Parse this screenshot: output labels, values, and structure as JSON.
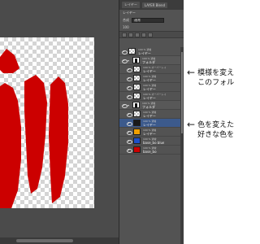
{
  "panel": {
    "tabs": [
      "レイヤー",
      "LAYER Blend"
    ],
    "header_text": "レイヤー",
    "blend_label": "合成",
    "blend_value": "通常",
    "opacity_label": "100",
    "layers": [
      {
        "pct": "100 % 通常",
        "name": "レイヤー",
        "thumb": "checker",
        "indent": 0,
        "type": "layer",
        "selected": false
      },
      {
        "pct": "100 % 通常",
        "name": "フォルダ",
        "thumb": "folder",
        "indent": 0,
        "type": "folder",
        "selected": false
      },
      {
        "pct": "100 % オーバーレイ",
        "name": "レイヤー",
        "thumb": "checker",
        "indent": 1,
        "type": "layer",
        "selected": false
      },
      {
        "pct": "100 % 通常",
        "name": "レイヤー",
        "thumb": "checker",
        "indent": 1,
        "type": "layer",
        "selected": false
      },
      {
        "pct": "100 % 通常",
        "name": "レイヤー",
        "thumb": "checker",
        "indent": 1,
        "type": "layer",
        "selected": false
      },
      {
        "pct": "100 % オーバーレイ",
        "name": "レイヤー",
        "thumb": "checker",
        "indent": 1,
        "type": "layer",
        "selected": false
      },
      {
        "pct": "100 % 通常",
        "name": "フォルダ",
        "thumb": "folder",
        "indent": 0,
        "type": "folder",
        "selected": false
      },
      {
        "pct": "100 % 通常",
        "name": "レイヤー",
        "thumb": "checker",
        "indent": 1,
        "type": "layer",
        "selected": false
      },
      {
        "pct": "100 % 通常",
        "name": "レイヤー",
        "thumb": "color-black",
        "indent": 1,
        "type": "layer",
        "selected": true
      },
      {
        "pct": "100 % 通常",
        "name": "レイヤー",
        "thumb": "color-orange",
        "indent": 1,
        "type": "layer",
        "selected": false
      },
      {
        "pct": "100 % 通常",
        "name": "base_bo blue",
        "thumb": "color-blue",
        "indent": 1,
        "type": "layer",
        "selected": false
      },
      {
        "pct": "100 % 通常",
        "name": "base_bo",
        "thumb": "color-red",
        "indent": 1,
        "type": "layer",
        "selected": false
      }
    ]
  },
  "annotations": [
    {
      "lines": [
        "模様を変え",
        "このフォル"
      ]
    },
    {
      "lines": [
        "色を変えた",
        "好きな色を"
      ]
    }
  ],
  "colors": {
    "artwork_red": "#cc0000",
    "thumb-color-black": "#1a1a1a",
    "thumb-color-orange": "#f0a000",
    "thumb-color-blue": "#1e50c8",
    "thumb-color-red": "#cc0000"
  }
}
